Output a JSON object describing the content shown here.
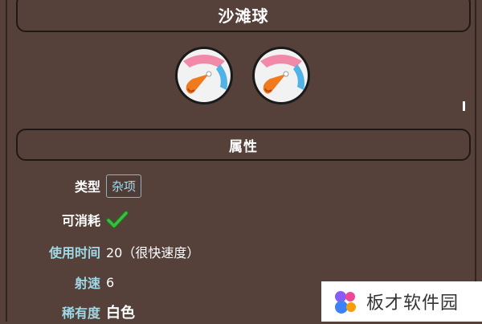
{
  "item": {
    "name": "沙滩球",
    "icon_names": [
      "beach-ball-icon",
      "beach-ball-icon"
    ]
  },
  "section": {
    "title": "属性"
  },
  "properties": {
    "type_label": "类型",
    "type_value": "杂项",
    "consumable_label": "可消耗",
    "consumable_icon": "checkmark-icon",
    "use_time_label": "使用时间",
    "use_time_value": "20（很快速度）",
    "velocity_label": "射速",
    "velocity_value": "6",
    "rarity_label": "稀有度",
    "rarity_value": "白色"
  },
  "watermark": {
    "text": "板才软件园"
  },
  "colors": {
    "background": "#55403a",
    "label_white": "#ffffff",
    "label_cyan": "#9fd9e6",
    "tag_text": "#a8d8e8",
    "check_green": "#3bbd3f"
  }
}
